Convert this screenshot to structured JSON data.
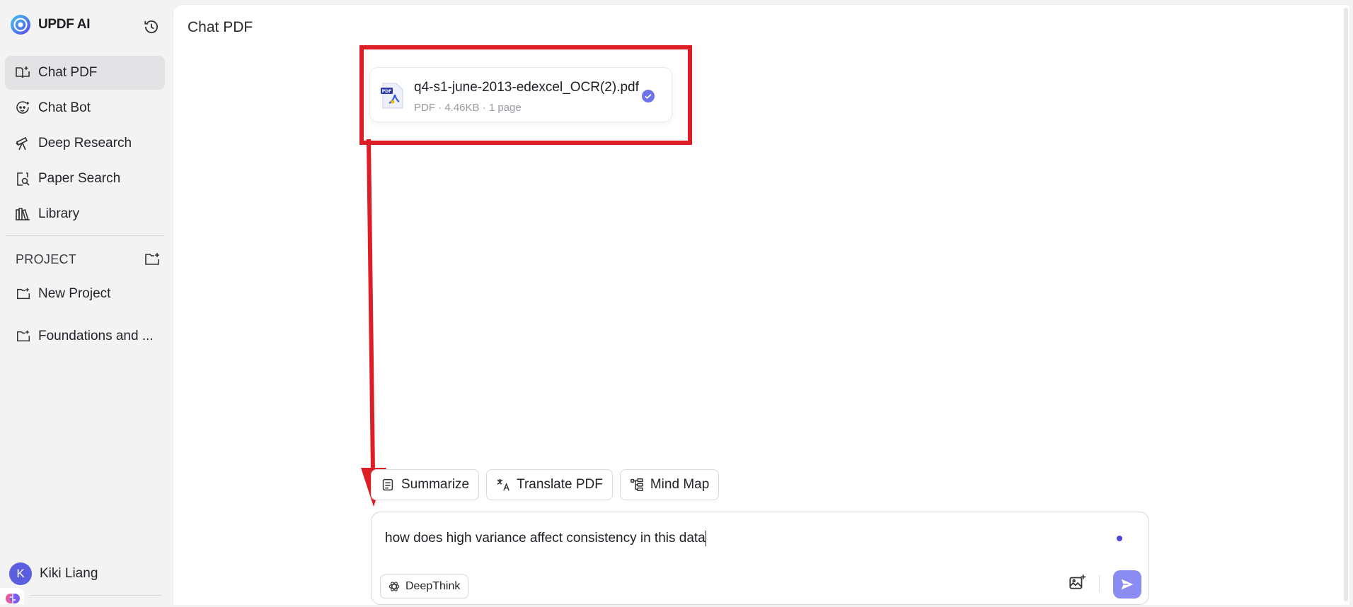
{
  "app": {
    "name": "UPDF AI"
  },
  "sidebar": {
    "items": [
      {
        "label": "Chat PDF",
        "icon": "chat-pdf-icon",
        "active": true
      },
      {
        "label": "Chat Bot",
        "icon": "chat-bot-icon",
        "active": false
      },
      {
        "label": "Deep Research",
        "icon": "telescope-icon",
        "active": false
      },
      {
        "label": "Paper Search",
        "icon": "paper-search-icon",
        "active": false
      },
      {
        "label": "Library",
        "icon": "library-icon",
        "active": false
      }
    ],
    "project_title": "PROJECT",
    "projects": [
      {
        "label": "New Project"
      },
      {
        "label": "Foundations and ..."
      }
    ],
    "user": {
      "initial": "K",
      "name": "Kiki Liang"
    }
  },
  "main": {
    "title": "Chat PDF",
    "file": {
      "name": "q4-s1-june-2013-edexcel_OCR(2).pdf",
      "meta": "PDF · 4.46KB · 1 page",
      "icon_badge": "PDF"
    },
    "actions": [
      {
        "label": "Summarize",
        "icon": "summarize-icon"
      },
      {
        "label": "Translate PDF",
        "icon": "translate-icon"
      },
      {
        "label": "Mind Map",
        "icon": "mind-map-icon"
      }
    ],
    "composer": {
      "value": "how does high variance affect consistency in this data",
      "deepthink_label": "DeepThink"
    }
  },
  "colors": {
    "accent": "#8a8cf2",
    "annotation_red": "#dd1e24",
    "avatar": "#5a5fe0",
    "sidebar_active": "#e3e3e6"
  }
}
